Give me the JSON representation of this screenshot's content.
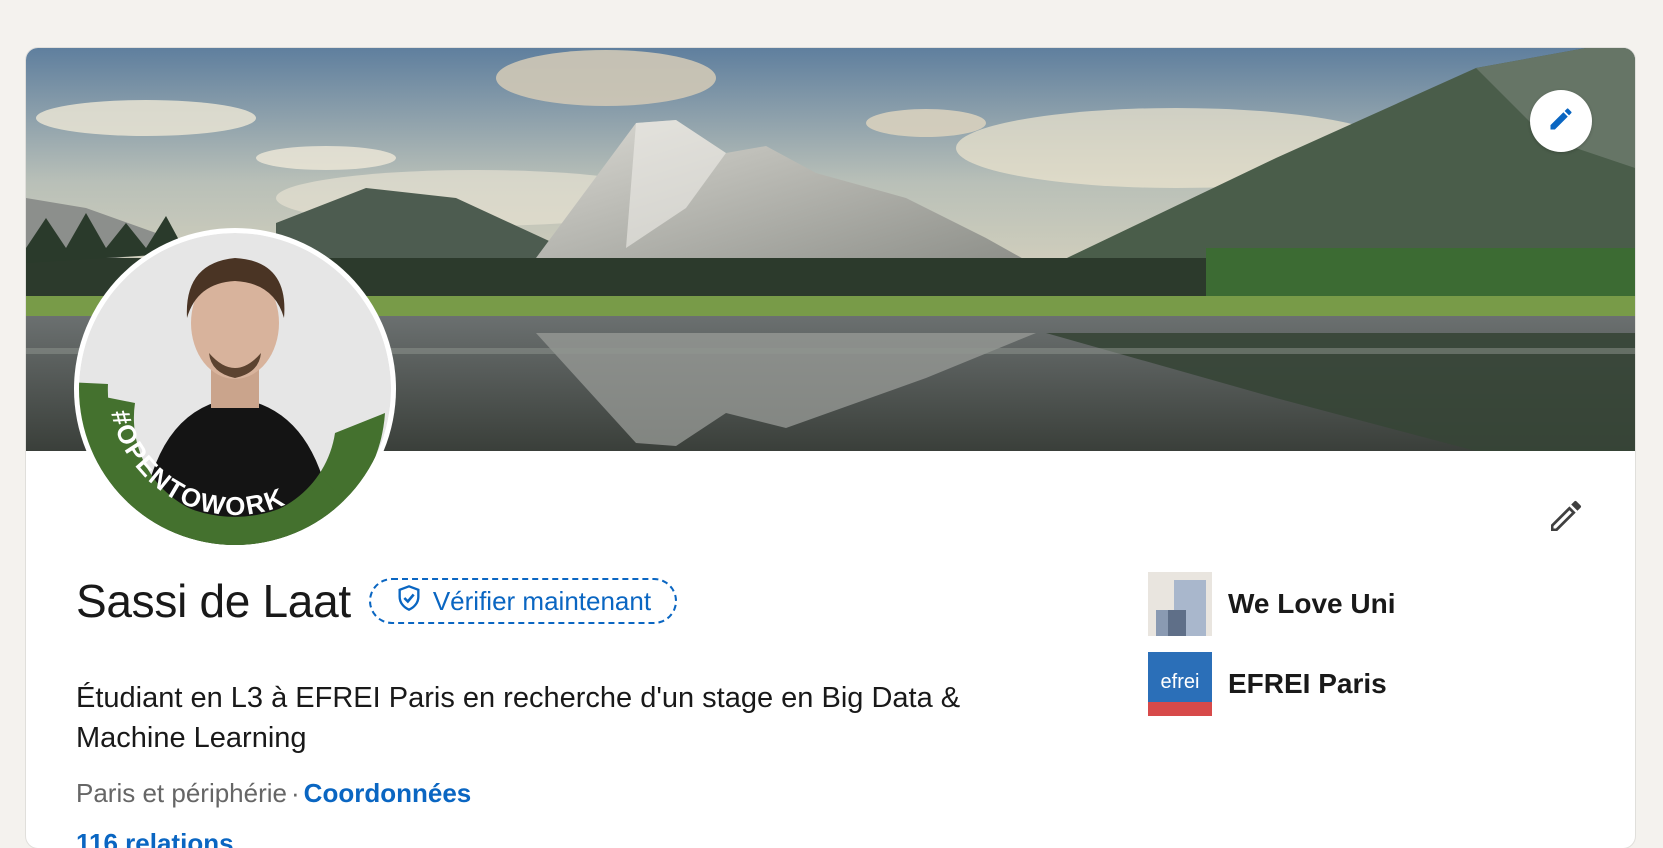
{
  "profile": {
    "name": "Sassi de Laat",
    "verify_label": "Vérifier maintenant",
    "headline": "Étudiant en L3 à EFREI Paris en recherche d'un stage en Big Data & Machine Learning",
    "location": "Paris et périphérie",
    "separator": "·",
    "contact_label": "Coordonnées",
    "relations_label": "116 relations",
    "open_to_work_label": "#OPENTOWORK"
  },
  "organizations": [
    {
      "label": "We Love Uni",
      "icon": "building-logo"
    },
    {
      "label": "EFREI Paris",
      "icon": "efrei-logo",
      "logo_text": "efrei"
    }
  ],
  "icons": {
    "banner_edit": "pencil-icon",
    "profile_edit": "pencil-icon",
    "verify": "shield-check-icon"
  },
  "colors": {
    "accent": "#0a66c2",
    "open_to_work_green": "#44712e",
    "page_bg": "#f4f2ee"
  }
}
